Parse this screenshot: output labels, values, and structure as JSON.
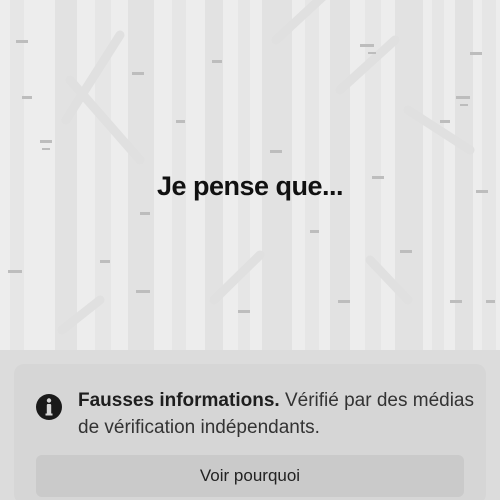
{
  "post": {
    "text": "Je pense que..."
  },
  "warning": {
    "icon": "info-icon",
    "title": "Fausses informations.",
    "description": "Vérifié par des médias de vérification indépendants.",
    "button_label": "Voir pourquoi"
  },
  "colors": {
    "image_background": "#ededed",
    "panel_background": "#dcdcdc",
    "button_background": "#cacaca",
    "icon_color": "#1a1a1a"
  }
}
